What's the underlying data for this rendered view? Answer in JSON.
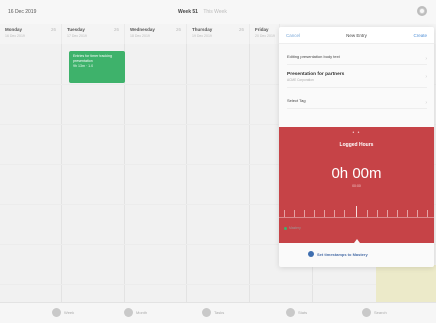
{
  "topbar": {
    "date_range": "16 Dec 2019",
    "week_label": "Week 51",
    "week_sub": "This Week"
  },
  "days": [
    {
      "name": "Monday",
      "date": "16 Dec 2019",
      "count": "26"
    },
    {
      "name": "Tuesday",
      "date": "17 Dec 2019",
      "count": "26"
    },
    {
      "name": "Wednesday",
      "date": "18 Dec 2019",
      "count": "26"
    },
    {
      "name": "Thursday",
      "date": "19 Dec 2019",
      "count": "26"
    },
    {
      "name": "Friday",
      "date": "20 Dec 2019",
      "count": ""
    }
  ],
  "event": {
    "title": "Entries for timer tracking presentation",
    "time": "9h 13m · 1.0"
  },
  "panel": {
    "cancel": "Cancel",
    "title": "New Entry",
    "create": "Create",
    "rows": [
      {
        "main": "Editing presentation body text",
        "sub": ""
      },
      {
        "main": "Presentation for partners",
        "sub": "ACME Corporation"
      },
      {
        "main": "Select Tag",
        "sub": ""
      }
    ],
    "logged": {
      "dots": "• •",
      "title": "Logged Hours",
      "value": "0h 00m",
      "sub": "00:00"
    },
    "tag_text": "Mastery",
    "set_button": "Set timestamps to Mastery"
  },
  "tabbar": [
    {
      "label": "Week",
      "icon": "calendar-icon"
    },
    {
      "label": "Month",
      "icon": "month-icon"
    },
    {
      "label": "Tasks",
      "icon": "tasks-icon"
    },
    {
      "label": "Stats",
      "icon": "stats-icon"
    },
    {
      "label": "Search",
      "icon": "search-icon"
    }
  ],
  "colors": {
    "accent": "#c64347",
    "event_green": "#3eb26b",
    "link_blue": "#4f8fd6"
  }
}
